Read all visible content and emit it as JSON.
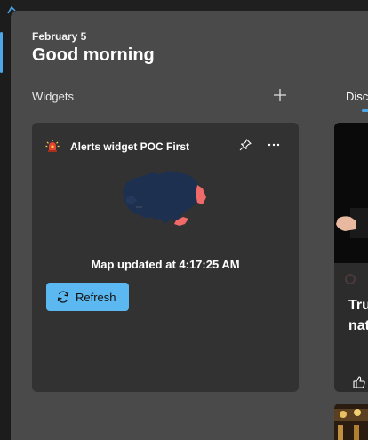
{
  "header": {
    "date": "February 5",
    "greeting": "Good morning"
  },
  "widgets_section": {
    "label": "Widgets",
    "add_icon": "plus-icon"
  },
  "discover_tab": {
    "label": "Disco"
  },
  "alert_widget": {
    "title": "Alerts widget POC First",
    "icon": "alert-siren-icon",
    "pin_icon": "pin-icon",
    "more_icon": "more-options-icon",
    "map_status": "Map updated at 4:17:25 AM",
    "refresh_label": "Refresh",
    "refresh_icon": "refresh-icon",
    "map_colors": {
      "base": "#1e3050",
      "alert": "#f06a6a"
    }
  },
  "news_feed": {
    "card1": {
      "headline_lines": [
        "Tru",
        "nat"
      ],
      "like_icon": "thumbs-up-icon"
    }
  },
  "colors": {
    "accent": "#4ca6e8",
    "refresh_button": "#5cb8f0",
    "panel_bg": "#4a4a4a",
    "card_bg": "#323232"
  }
}
